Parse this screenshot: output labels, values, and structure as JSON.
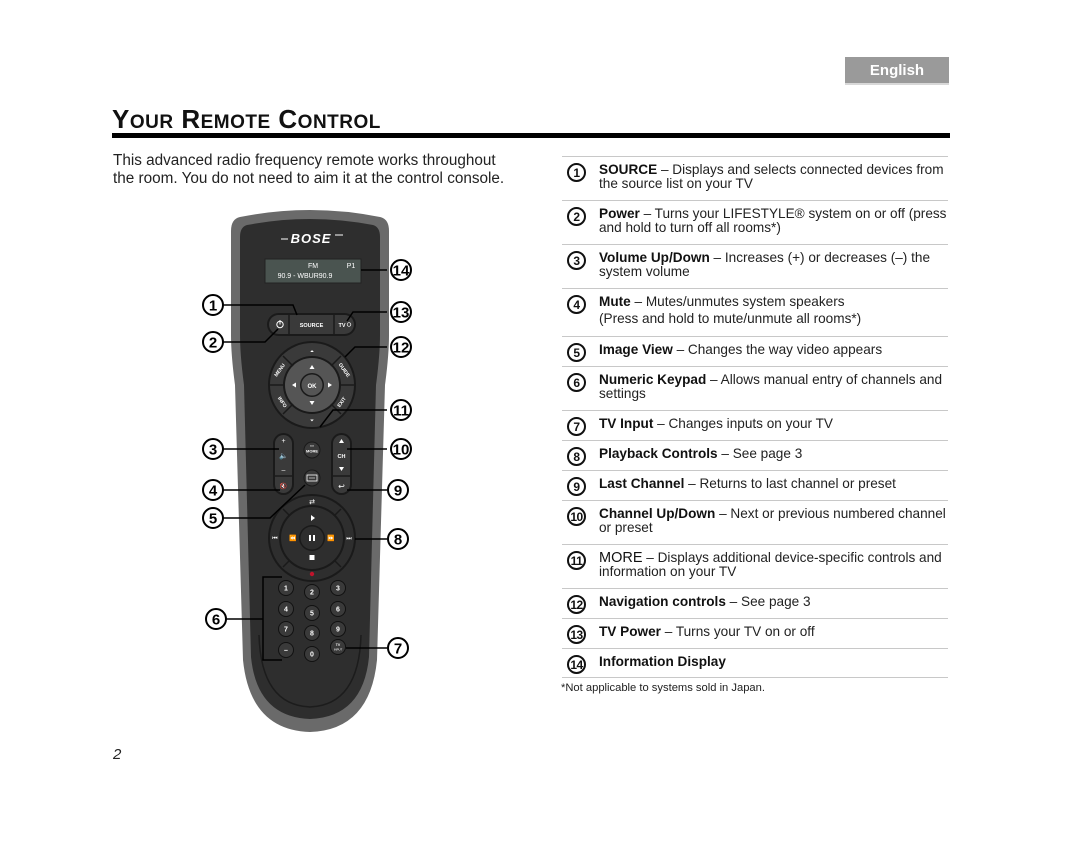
{
  "language_tab": "English",
  "title": {
    "parts": [
      {
        "cap": "Y",
        "rest": "OUR"
      },
      {
        "cap": "R",
        "rest": "EMOTE"
      },
      {
        "cap": "C",
        "rest": "ONTROL"
      }
    ]
  },
  "intro": "This advanced radio frequency remote works throughout the room. You do not need to aim it at the control console.",
  "remote": {
    "brand": "BOSE",
    "display": {
      "line1_left": "FM",
      "line1_right": "P1",
      "line2": "90.9 - WBUR90.9"
    },
    "buttons": {
      "source": "SOURCE",
      "tv": "TV",
      "ok": "OK",
      "menu": "MENU",
      "guide": "GUIDE",
      "info": "INFO",
      "exit": "EXIT",
      "more": "MORE",
      "ch": "CH",
      "tv_input": "TV INPUT",
      "keypad": [
        "1",
        "2",
        "3",
        "4",
        "5",
        "6",
        "7",
        "8",
        "9",
        "–",
        "0"
      ]
    },
    "callouts": [
      "1",
      "2",
      "3",
      "4",
      "5",
      "6",
      "7",
      "8",
      "9",
      "10",
      "11",
      "12",
      "13",
      "14"
    ]
  },
  "features": [
    {
      "num": "1",
      "term": "SOURCE",
      "desc": " – Displays and selects connected devices from the source list on your TV"
    },
    {
      "num": "2",
      "term": "Power",
      "desc": " – Turns your LIFESTYLE® system on or off (press and hold to turn off all rooms*)"
    },
    {
      "num": "3",
      "term": "Volume Up/Down",
      "desc": " – Increases (+) or decreases (–) the system volume"
    },
    {
      "num": "4",
      "term": "Mute",
      "desc": " – Mutes/unmutes system speakers",
      "desc2": "(Press and hold to mute/unmute all rooms*)"
    },
    {
      "num": "5",
      "term": "Image View",
      "desc": " – Changes the way video appears"
    },
    {
      "num": "6",
      "term": "Numeric Keypad",
      "desc": " – Allows manual entry of channels and settings"
    },
    {
      "num": "7",
      "term": "TV Input",
      "desc": " – Changes inputs on your TV"
    },
    {
      "num": "8",
      "term": "Playback Controls",
      "desc": " – See page 3"
    },
    {
      "num": "9",
      "term": "Last Channel",
      "desc": " – Returns to last channel or preset"
    },
    {
      "num": "10",
      "term": "Channel Up/Down",
      "desc": " – Next or previous numbered channel or preset"
    },
    {
      "num": "11",
      "term": "MORE",
      "desc": " – Displays additional device-specific controls and information on your TV"
    },
    {
      "num": "12",
      "term": "Navigation controls",
      "desc": " – See page 3"
    },
    {
      "num": "13",
      "term": "TV Power",
      "desc": " – Turns your TV on or off"
    },
    {
      "num": "14",
      "term": "Information Display",
      "desc": ""
    }
  ],
  "footnote": "*Not applicable to systems sold in Japan.",
  "page_number": "2",
  "colors": {
    "tab_bg": "#9a9a9a",
    "remote_body": "#2e2e2e",
    "remote_rim": "#6a6a6a",
    "display_bg": "#4a5450",
    "record_dot": "#c0142c"
  }
}
